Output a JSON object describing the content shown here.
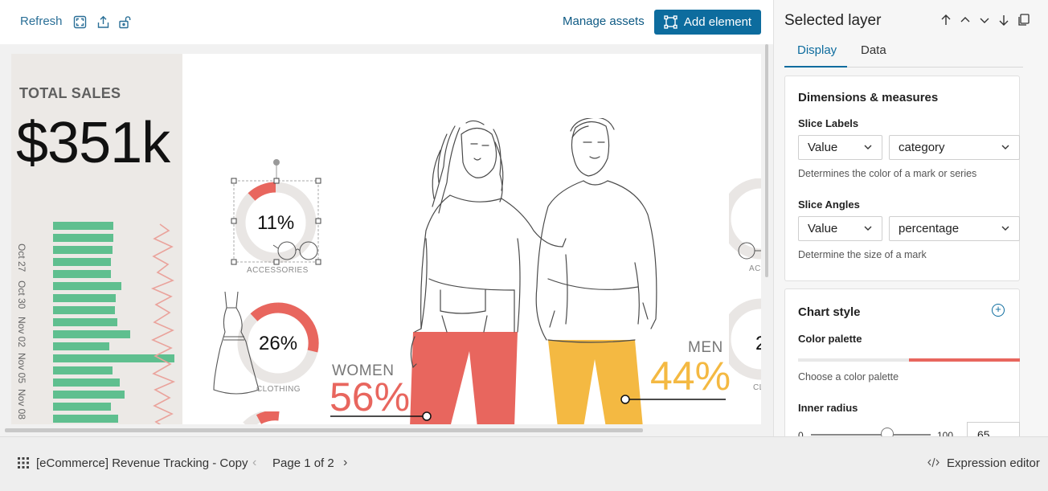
{
  "toolbar": {
    "refresh_label": "Refresh",
    "manage_assets_label": "Manage assets",
    "add_element_label": "Add element",
    "accent_color": "#0d6c9e"
  },
  "canvas": {
    "total_sales_label": "TOTAL SALES",
    "total_sales_value": "$351k",
    "dates": [
      "Oct 27",
      "Oct 30",
      "Nov 02",
      "Nov 05",
      "Nov 08"
    ],
    "donuts": [
      {
        "percent": "11%",
        "category": "ACCESSORIES",
        "value": 11
      },
      {
        "percent": "26%",
        "category": "CLOTHING",
        "value": 26
      }
    ],
    "partial_right_labels": [
      "ACC",
      "CL",
      "2"
    ],
    "women_label": "WOMEN",
    "women_percent": "56%",
    "men_label": "MEN",
    "men_percent": "44%",
    "colors": {
      "women": "#e8665e",
      "men": "#f4b942",
      "bars": "#5fbf8f",
      "donut_track": "#e9e6e4"
    }
  },
  "sidebar": {
    "title": "Selected layer",
    "tabs": [
      {
        "label": "Display",
        "active": true
      },
      {
        "label": "Data",
        "active": false
      }
    ],
    "dims_card": {
      "title": "Dimensions & measures",
      "slice_labels": {
        "label": "Slice Labels",
        "left": "Value",
        "right": "category",
        "hint": "Determines the color of a mark or series"
      },
      "slice_angles": {
        "label": "Slice Angles",
        "left": "Value",
        "right": "percentage",
        "hint": "Determine the size of a mark"
      }
    },
    "style_card": {
      "title": "Chart style",
      "palette_label": "Color palette",
      "palette_hint": "Choose a color palette",
      "inner_radius_label": "Inner radius",
      "min": "0",
      "max": "100",
      "value": "65"
    }
  },
  "bottombar": {
    "document_title": "[eCommerce] Revenue Tracking - Copy",
    "page_label": "Page 1 of 2",
    "expression_editor_label": "Expression editor"
  }
}
